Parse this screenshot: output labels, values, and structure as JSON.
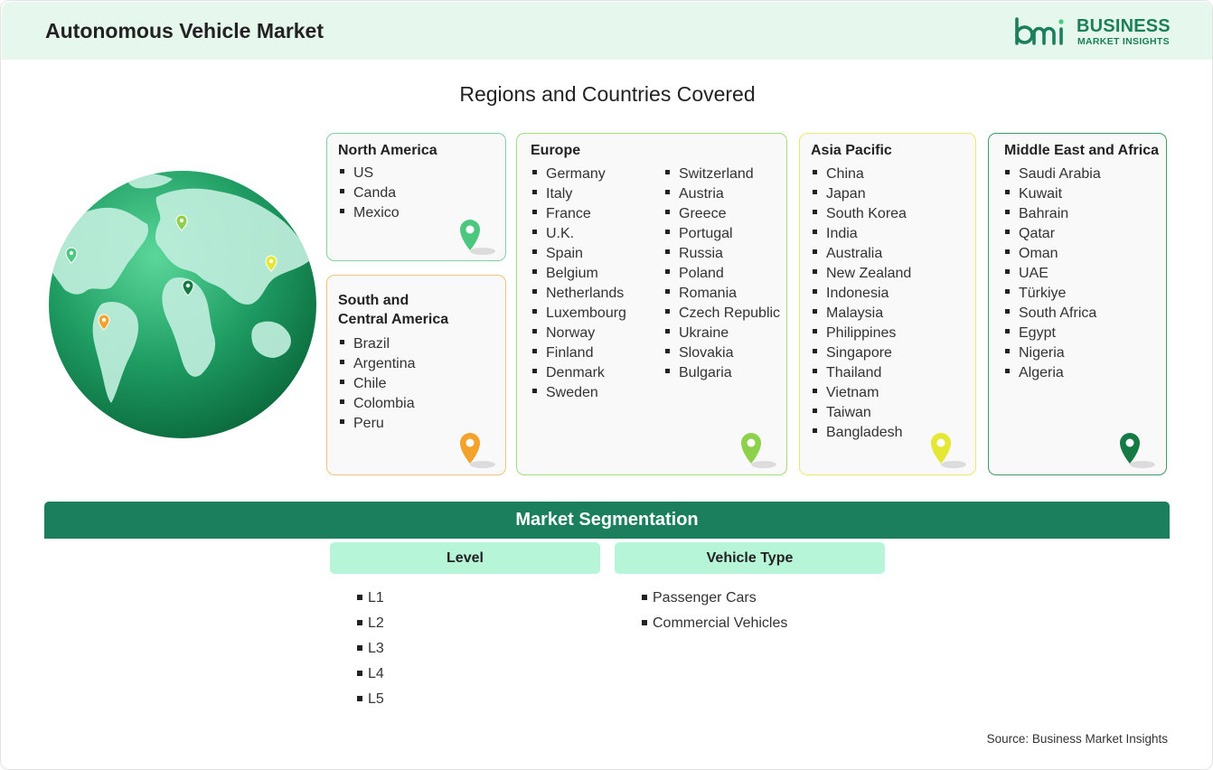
{
  "header": {
    "title": "Autonomous Vehicle Market"
  },
  "logo": {
    "line1": "BUSINESS",
    "line2": "MARKET INSIGHTS",
    "mark_text": "bmi",
    "color": "#1a7f5a"
  },
  "regions_title": "Regions and Countries Covered",
  "regions": {
    "north_america": {
      "title": "North America",
      "items": [
        "US",
        "Canda",
        "Mexico"
      ],
      "pin_color": "#4cc77e"
    },
    "south_central_america": {
      "title_line1": "South and",
      "title_line2": "Central America",
      "items": [
        "Brazil",
        "Argentina",
        "Chile",
        "Colombia",
        "Peru"
      ],
      "pin_color": "#f3a22b"
    },
    "europe": {
      "title": "Europe",
      "col1": [
        "Germany",
        "Italy",
        "France",
        "U.K.",
        "Spain",
        "Belgium",
        "Netherlands",
        "Luxembourg",
        "Norway",
        "Finland",
        "Denmark",
        "Sweden"
      ],
      "col2": [
        "Switzerland",
        "Austria",
        "Greece",
        "Portugal",
        "Russia",
        "Poland",
        "Romania",
        "Czech Republic",
        "Ukraine",
        "Slovakia",
        "Bulgaria"
      ],
      "pin_color": "#8dd14a"
    },
    "asia_pacific": {
      "title": "Asia Pacific",
      "items": [
        "China",
        "Japan",
        "South Korea",
        "India",
        "Australia",
        "New Zealand",
        "Indonesia",
        "Malaysia",
        "Philippines",
        "Singapore",
        "Thailand",
        "Vietnam",
        "Taiwan",
        "Bangladesh"
      ],
      "pin_color": "#e4e834"
    },
    "middle_east_africa": {
      "title": "Middle East and Africa",
      "items": [
        "Saudi Arabia",
        "Kuwait",
        "Bahrain",
        "Qatar",
        "Oman",
        "UAE",
        "Türkiye",
        "South Africa",
        "Egypt",
        "Nigeria",
        "Algeria"
      ],
      "pin_color": "#167a45"
    }
  },
  "segmentation": {
    "title": "Market Segmentation",
    "level": {
      "title": "Level",
      "items": [
        "L1",
        "L2",
        "L3",
        "L4",
        "L5"
      ]
    },
    "vehicle_type": {
      "title": "Vehicle Type",
      "items": [
        "Passenger Cars",
        "Commercial Vehicles"
      ]
    }
  },
  "source": "Source: Business Market Insights"
}
